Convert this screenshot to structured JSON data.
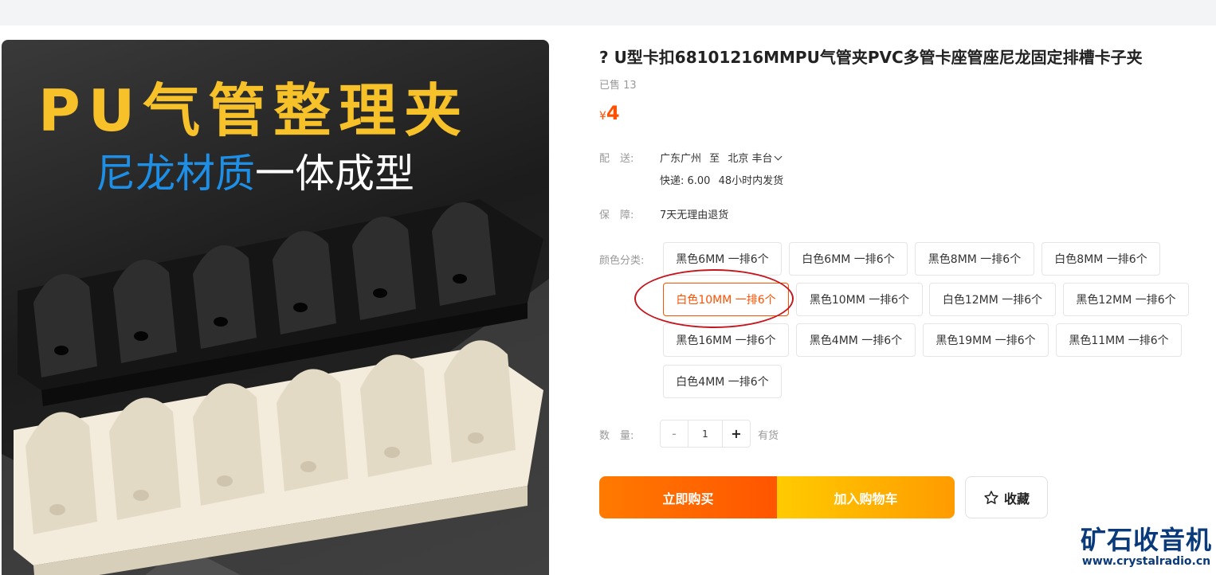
{
  "product": {
    "title": "? U型卡扣68101216MMPU气管夹PVC多管卡座管座尼龙固定排槽卡子夹",
    "sold": "已售 13",
    "price_currency": "¥",
    "price_value": "4"
  },
  "image": {
    "headline": "PU气管整理夹",
    "sub_blue": "尼龙材质",
    "sub_white": "一体成型"
  },
  "delivery": {
    "label": "配　送:",
    "from": "广东广州",
    "to_word": "至",
    "to": "北京 丰台",
    "express": "快递: 6.00",
    "ship_time": "48小时内发货"
  },
  "guarantee": {
    "label": "保　障:",
    "text": "7天无理由退货"
  },
  "variants": {
    "label": "颜色分类:",
    "selected_index": 4,
    "options": [
      "黑色6MM 一排6个",
      "白色6MM 一排6个",
      "黑色8MM 一排6个",
      "白色8MM 一排6个",
      "白色10MM 一排6个",
      "黑色10MM 一排6个",
      "白色12MM 一排6个",
      "黑色12MM 一排6个",
      "黑色16MM 一排6个",
      "黑色4MM 一排6个",
      "黑色19MM 一排6个",
      "黑色11MM 一排6个",
      "白色4MM 一排6个"
    ]
  },
  "quantity": {
    "label": "数　量:",
    "minus": "-",
    "value": "1",
    "plus": "+",
    "stock": "有货"
  },
  "actions": {
    "buy": "立即购买",
    "cart": "加入购物车",
    "favorite": "收藏"
  },
  "watermark": {
    "title": "矿石收音机",
    "url": "www.crystalradio.cn"
  },
  "colors": {
    "accent": "#ff5000",
    "annotation": "#c4161c",
    "watermark": "#0a3a7a"
  }
}
